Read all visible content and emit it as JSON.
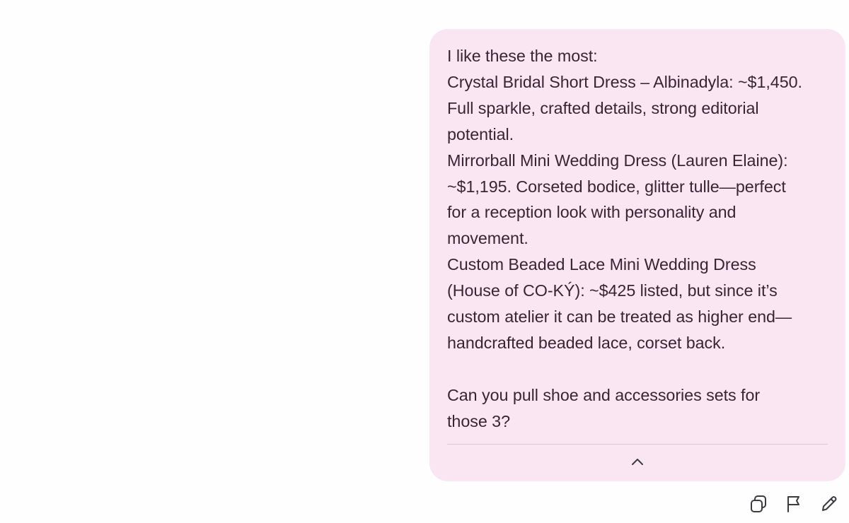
{
  "message": {
    "lines": [
      "I like these the most:",
      "Crystal Bridal Short Dress – Albinadyla: ~$1,450.",
      "Full sparkle, crafted details, strong editorial",
      "potential.",
      "Mirrorball Mini Wedding Dress (Lauren Elaine):",
      "~$1,195. Corseted bodice, glitter tulle—perfect",
      "for a reception look with personality and",
      "movement.",
      "Custom Beaded Lace Mini Wedding Dress",
      "(House of CO-KÝ): ~$425 listed, but since it’s",
      "custom atelier it can be treated as higher end—",
      "handcrafted beaded lace, corset back."
    ],
    "question_lines": [
      "Can you pull shoe and accessories sets for",
      "those 3?"
    ],
    "collapse_icon": "chevron-up-icon"
  },
  "actions": [
    {
      "name": "copy",
      "icon": "copy-icon"
    },
    {
      "name": "flag",
      "icon": "flag-icon"
    },
    {
      "name": "edit",
      "icon": "pencil-icon"
    }
  ],
  "colors": {
    "page_background": "#fefefe",
    "bubble_background": "#f9e6f2",
    "text": "#3a2433",
    "divider": "#d8c9d2",
    "icon": "#3b3b3f"
  }
}
